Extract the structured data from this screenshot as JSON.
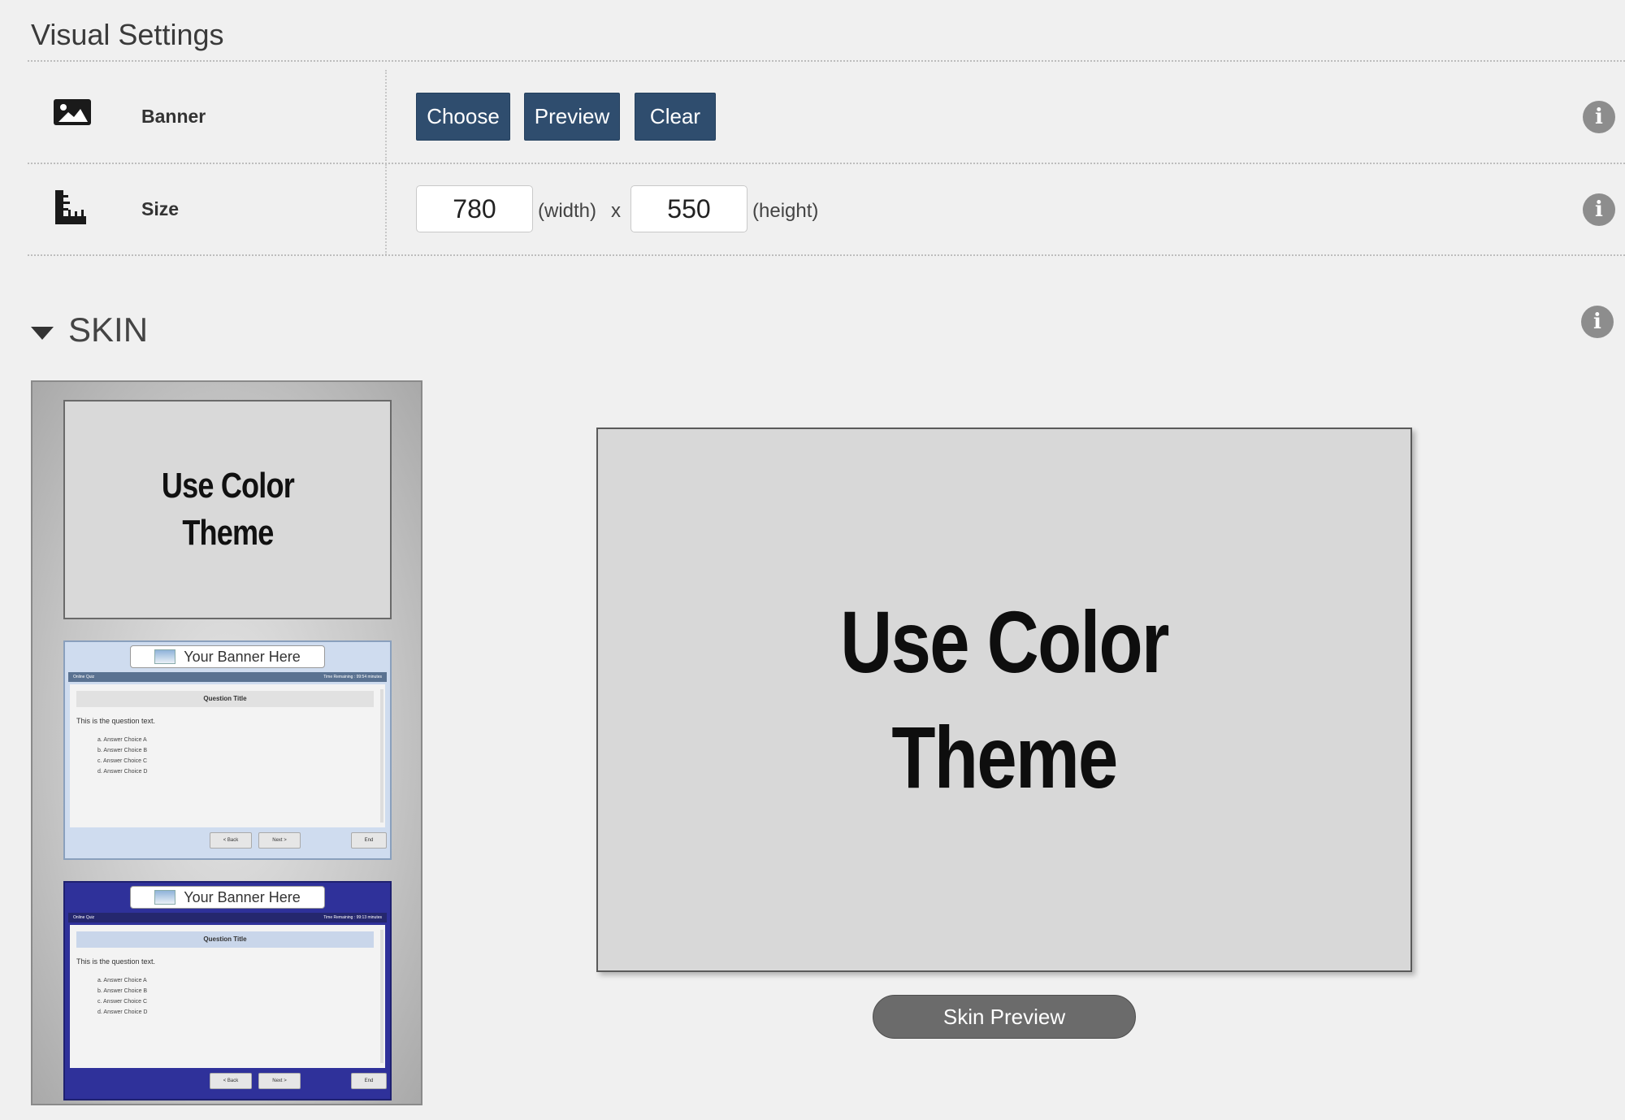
{
  "section_title": "Visual Settings",
  "banner": {
    "label": "Banner",
    "icon": "image-icon",
    "buttons": {
      "choose": "Choose",
      "preview": "Preview",
      "clear": "Clear"
    }
  },
  "size": {
    "label": "Size",
    "icon": "ruler-icon",
    "width": "780",
    "width_unit": "(width)",
    "separator": "x",
    "height": "550",
    "height_unit": "(height)"
  },
  "info_icon_glyph": "i",
  "skin": {
    "title": "SKIN",
    "thumbnails": [
      {
        "type": "color-theme",
        "line1": "Use Color",
        "line2": "Theme"
      },
      {
        "type": "light",
        "banner": "Your Banner Here",
        "bar_left": "Online Quiz",
        "bar_right": "Time Remaining : 99:54 minutes",
        "question_title": "Question Title",
        "question_text": "This is the question text.",
        "choices": [
          "a.   Answer Choice A",
          "b.   Answer Choice B",
          "c.   Answer Choice C",
          "d.   Answer Choice D"
        ],
        "back": "< Back",
        "next": "Next >",
        "end": "End"
      },
      {
        "type": "dark",
        "banner": "Your Banner Here",
        "bar_left": "Online Quiz",
        "bar_right": "Time Remaining : 99:13 minutes",
        "question_title": "Question Title",
        "question_text": "This is the question text.",
        "choices": [
          "a.   Answer Choice A",
          "b.   Answer Choice B",
          "c.   Answer Choice C",
          "d.   Answer Choice D"
        ],
        "back": "< Back",
        "next": "Next >",
        "end": "End"
      }
    ],
    "preview": {
      "line1": "Use Color",
      "line2": "Theme"
    },
    "preview_button": "Skin Preview"
  },
  "colors": {
    "button": "#2f4d6e",
    "info": "#8d8d8d",
    "pill": "#6b6b6b"
  }
}
